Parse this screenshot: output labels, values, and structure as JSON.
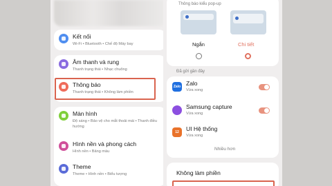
{
  "left": {
    "items": [
      {
        "title": "Kết nối",
        "subtitle": "Wi-Fi  •  Bluetooth  •  Chế độ Máy bay",
        "icon": "wifi-icon",
        "color": "#4f8ef0"
      },
      {
        "title": "Âm thanh và rung",
        "subtitle": "Thanh trạng thái  •  Nhạc chuông",
        "icon": "volume-icon",
        "color": "#8a6ce0"
      },
      {
        "title": "Thông báo",
        "subtitle": "Thanh trạng thái  •  Không làm phiền",
        "icon": "notification-icon",
        "color": "#ef6b5a"
      },
      {
        "title": "Màn hình",
        "subtitle": "Độ sáng  •  Bảo vệ cho mắt thoải mái  •  Thanh điều hướng",
        "icon": "display-icon",
        "color": "#7fcf3a"
      },
      {
        "title": "Hình nền và phong cách",
        "subtitle": "Hình nền  •  Bảng màu",
        "icon": "wallpaper-icon",
        "color": "#d0509a"
      },
      {
        "title": "Theme",
        "subtitle": "Theme  •  Hình nền  •  Biểu tượng",
        "icon": "theme-icon",
        "color": "#5a6bd8"
      }
    ]
  },
  "right": {
    "popup_section_label": "Thông báo kiểu pop-up",
    "options": [
      {
        "label": "Ngắn",
        "selected": false
      },
      {
        "label": "Chi tiết",
        "selected": true
      }
    ],
    "accent": "#e0715f",
    "recent_label": "Đã gửi gần đây",
    "apps": [
      {
        "name": "Zalo",
        "time": "Vừa xong",
        "icon_text": "Zalo",
        "color": "#1f6fe0",
        "toggle_on": true
      },
      {
        "name": "Samsung capture",
        "time": "Vừa xong",
        "icon_text": "",
        "color": "#8c4fe0",
        "toggle_on": true
      },
      {
        "name": "UI Hệ thống",
        "time": "Vừa xong",
        "icon_text": "12",
        "color": "#e9722a",
        "toggle_on": false
      }
    ],
    "more_label": "Nhiều hơn",
    "dnd_label": "Không làm phiền"
  }
}
